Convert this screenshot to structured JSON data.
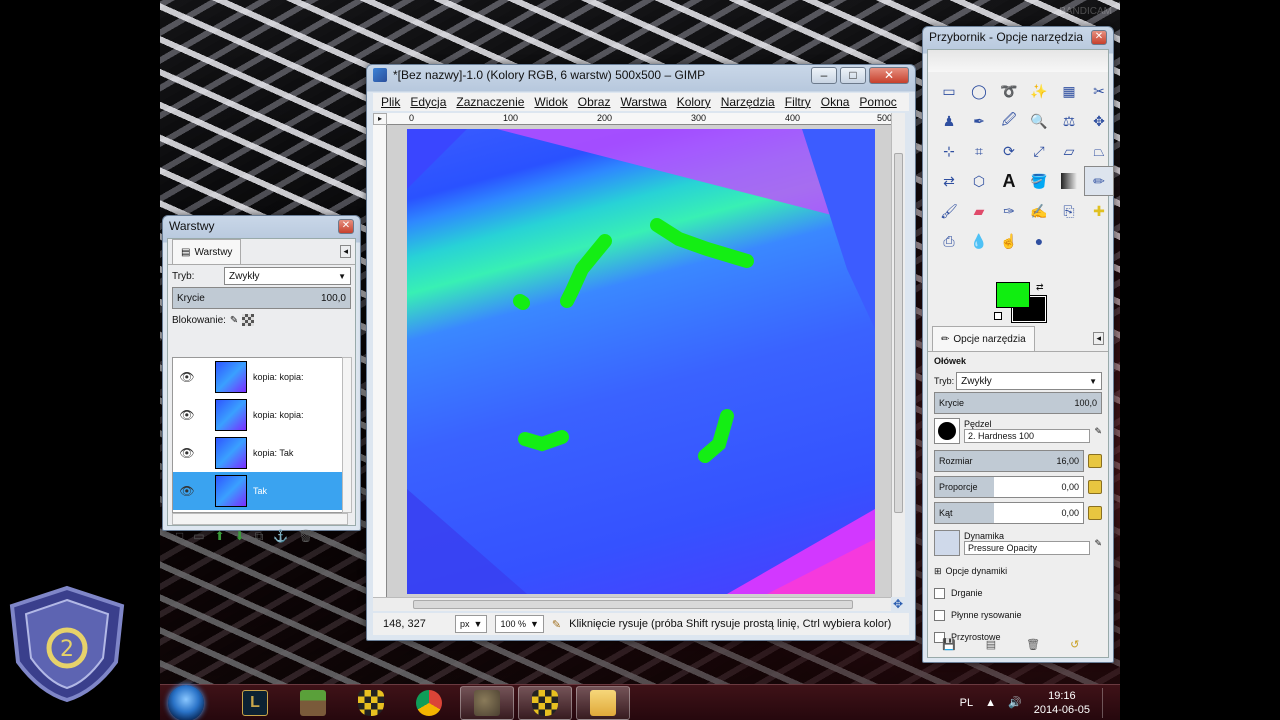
{
  "watermark": "BANDICAM",
  "layers_window": {
    "title": "Warstwy",
    "tab_label": "Warstwy",
    "mode_label": "Tryb:",
    "mode_value": "Zwykły",
    "opacity_label": "Krycie",
    "opacity_value": "100,0",
    "lock_label": "Blokowanie:",
    "layers": [
      {
        "name": "kopia: kopia:",
        "visible": true,
        "selected": false
      },
      {
        "name": "kopia: kopia:",
        "visible": true,
        "selected": false
      },
      {
        "name": "kopia: Tak",
        "visible": true,
        "selected": false
      },
      {
        "name": "Tak",
        "visible": true,
        "selected": true
      }
    ]
  },
  "gimp_window": {
    "title": "*[Bez nazwy]-1.0 (Kolory RGB, 6 warstw) 500x500 – GIMP",
    "menu": [
      "Plik",
      "Edycja",
      "Zaznaczenie",
      "Widok",
      "Obraz",
      "Warstwa",
      "Kolory",
      "Narzędzia",
      "Filtry",
      "Okna",
      "Pomoc"
    ],
    "ruler_ticks": [
      "0",
      "100",
      "200",
      "300",
      "400",
      "500"
    ],
    "status": {
      "coords": "148, 327",
      "unit": "px",
      "zoom": "100 %",
      "message": "Kliknięcie rysuje (próba Shift rysuje prostą linię, Ctrl wybiera kolor)"
    }
  },
  "toolbox_window": {
    "title": "Przybornik - Opcje narzędzia",
    "colors": {
      "foreground": "#10ee10",
      "background": "#000000"
    },
    "tab_label": "Opcje narzędzia",
    "tool_name": "Ołówek",
    "mode_label": "Tryb:",
    "mode_value": "Zwykły",
    "opacity_label": "Krycie",
    "opacity_value": "100,0",
    "brush_label": "Pędzel",
    "brush_value": "2. Hardness 100",
    "size_label": "Rozmiar",
    "size_value": "16,00",
    "ratio_label": "Proporcje",
    "ratio_value": "0,00",
    "angle_label": "Kąt",
    "angle_value": "0,00",
    "dynamics_label": "Dynamika",
    "dynamics_value": "Pressure Opacity",
    "dynamics_options": "Opcje dynamiki",
    "jitter": "Drganie",
    "smooth": "Płynne rysowanie",
    "incremental": "Przyrostowe"
  },
  "taskbar": {
    "lang": "PL",
    "time": "19:16",
    "date": "2014-06-05"
  }
}
